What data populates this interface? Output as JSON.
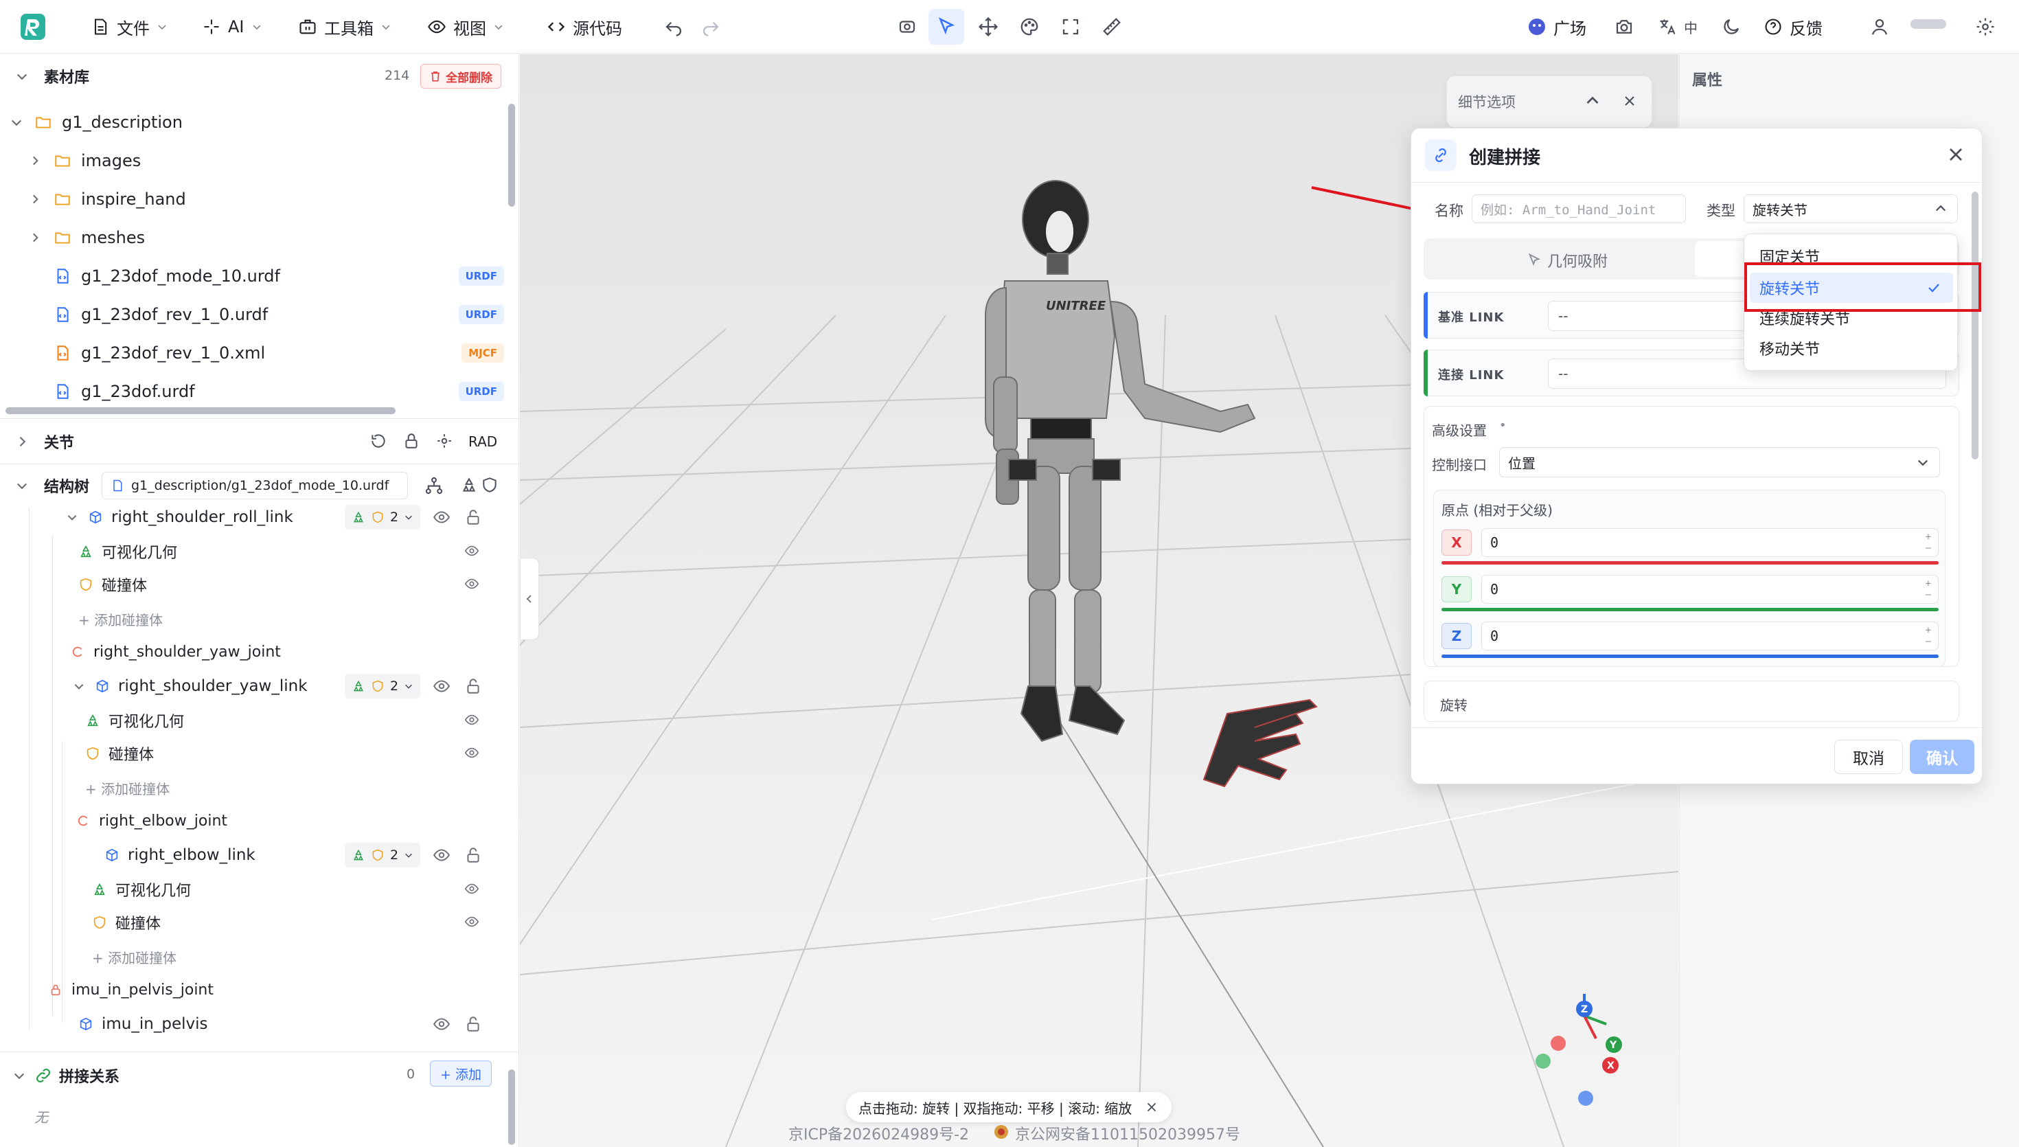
{
  "toolbar": {
    "file": "文件",
    "ai": "AI",
    "toolbox": "工具箱",
    "view": "视图",
    "source": "源代码",
    "plaza": "广场",
    "lang": "中",
    "feedback": "反馈"
  },
  "assets": {
    "title": "素材库",
    "count": "214",
    "delete_all": "全部删除",
    "root": "g1_description",
    "folders": [
      "images",
      "inspire_hand",
      "meshes"
    ],
    "files": [
      {
        "name": "g1_23dof_mode_10.urdf",
        "tag": "URDF"
      },
      {
        "name": "g1_23dof_rev_1_0.urdf",
        "tag": "URDF"
      },
      {
        "name": "g1_23dof_rev_1_0.xml",
        "tag": "MJCF"
      },
      {
        "name": "g1_23dof.urdf",
        "tag": "URDF"
      }
    ]
  },
  "joints": {
    "title": "关节",
    "unit": "RAD"
  },
  "structure": {
    "title": "结构树",
    "file": "g1_description/g1_23dof_mode_10.urdf",
    "rows": {
      "r1": "right_shoulder_roll_link",
      "r1c": "2",
      "r2": "可视化几何",
      "r3": "碰撞体",
      "r4": "+ 添加碰撞体",
      "r5": "right_shoulder_yaw_joint",
      "r6": "right_shoulder_yaw_link",
      "r6c": "2",
      "r7": "可视化几何",
      "r8": "碰撞体",
      "r9": "+ 添加碰撞体",
      "r10": "right_elbow_joint",
      "r11": "right_elbow_link",
      "r11c": "2",
      "r12": "可视化几何",
      "r13": "碰撞体",
      "r14": "+ 添加碰撞体",
      "r15": "imu_in_pelvis_joint",
      "r16": "imu_in_pelvis"
    }
  },
  "splice": {
    "title": "拼接关系",
    "count": "0",
    "add": "+ 添加",
    "empty": "无"
  },
  "viewport": {
    "hint": "点击拖动: 旋转 | 双指拖动: 平移 | 滚动: 缩放",
    "icp": "京ICP备2026024989号-2",
    "police": "京公网安备11011502039957号"
  },
  "right_panel": {
    "title": "属性"
  },
  "detail_card": {
    "title": "细节选项"
  },
  "dialog": {
    "title": "创建拼接",
    "name_label": "名称",
    "name_placeholder": "例如: Arm_to_Hand_Joint",
    "type_label": "类型",
    "type_value": "旋转关节",
    "tab_geo": "几何吸附",
    "base_link_label": "基准 LINK",
    "base_link_value": "--",
    "child_link_label": "连接 LINK",
    "child_link_value": "--",
    "advanced": "高级设置",
    "advanced_dot": "•",
    "control_label": "控制接口",
    "control_value": "位置",
    "origin_label": "原点 (相对于父级)",
    "x": "0",
    "y": "0",
    "z": "0",
    "rotation": "旋转",
    "cancel": "取消",
    "confirm": "确认"
  },
  "dropdown": {
    "options": [
      "固定关节",
      "旋转关节",
      "连续旋转关节",
      "移动关节"
    ],
    "selected": "旋转关节"
  },
  "colors": {
    "accent": "#3370ff",
    "x_axis": "#e0323a",
    "y_axis": "#2aa04a",
    "z_axis": "#2f6de0",
    "annotation": "#e0141e"
  }
}
